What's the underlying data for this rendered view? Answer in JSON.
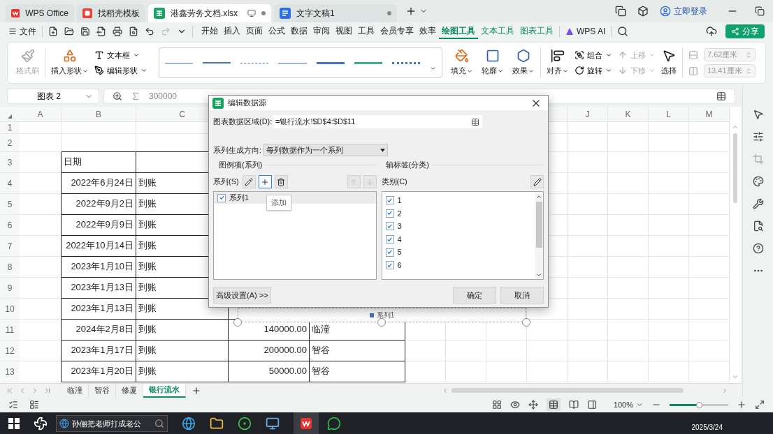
{
  "tabs": [
    {
      "label": "WPS Office",
      "kind": "wps",
      "selected": false
    },
    {
      "label": "找稻壳模板",
      "kind": "docer",
      "selected": false
    },
    {
      "label": "港鑫劳务文档.xlsx",
      "kind": "sheet",
      "selected": true
    },
    {
      "label": "文字文稿1",
      "kind": "writer",
      "selected": false
    }
  ],
  "account": "立即登录",
  "menu": {
    "file": "文件",
    "tabs": [
      {
        "label": "开始",
        "selected": false,
        "contextual": false
      },
      {
        "label": "插入",
        "selected": false,
        "contextual": false
      },
      {
        "label": "页面",
        "selected": false,
        "contextual": false
      },
      {
        "label": "公式",
        "selected": false,
        "contextual": false
      },
      {
        "label": "数据",
        "selected": false,
        "contextual": false
      },
      {
        "label": "审阅",
        "selected": false,
        "contextual": false
      },
      {
        "label": "视图",
        "selected": false,
        "contextual": false
      },
      {
        "label": "工具",
        "selected": false,
        "contextual": false
      },
      {
        "label": "会员专享",
        "selected": false,
        "contextual": false
      },
      {
        "label": "效率",
        "selected": false,
        "contextual": false
      },
      {
        "label": "绘图工具",
        "selected": true,
        "contextual": true
      },
      {
        "label": "文本工具",
        "selected": false,
        "contextual": true
      },
      {
        "label": "图表工具",
        "selected": false,
        "contextual": true
      }
    ],
    "ai": "WPS AI",
    "share": "分享"
  },
  "ribbon": {
    "format_painter": {
      "label": "格式刷",
      "disabled": true
    },
    "insert_shape": "插入形状",
    "text_box": "文本框",
    "edit_shape": "编辑形状",
    "line_styles": [
      {
        "kind": "thin",
        "color": "#4472c4"
      },
      {
        "kind": "medium",
        "color": "#4472c4"
      },
      {
        "kind": "dashed",
        "color": "#4472c4"
      },
      {
        "kind": "thin",
        "color": "#4472c4"
      },
      {
        "kind": "thick",
        "color": "#4472c4"
      },
      {
        "kind": "thick",
        "color": "#3bb18a"
      },
      {
        "kind": "dotted",
        "color": "#4472c4"
      }
    ],
    "fill": "填充",
    "outline": "轮廓",
    "effect": "效果",
    "align": "对齐",
    "group": "组合",
    "rotate": "旋转",
    "bring_forward": {
      "label": "上移",
      "disabled": true
    },
    "send_backward": {
      "label": "下移",
      "disabled": true
    },
    "select": "选择",
    "height": {
      "value": "7.62厘米",
      "disabled": true
    },
    "width": {
      "value": "13.41厘米",
      "disabled": true
    }
  },
  "formula_bar": {
    "name_box": "图表 2",
    "value": "300000"
  },
  "sheet": {
    "columns_left": [
      "A",
      "B",
      "C"
    ],
    "columns_right": [
      "J",
      "K",
      "L",
      "M"
    ],
    "rows": [
      {
        "number": "1"
      },
      {
        "number": "2"
      },
      {
        "number": "3",
        "kind": "header",
        "date": "日期"
      },
      {
        "number": "4",
        "kind": "data",
        "date": "2022年6月24日",
        "status": "到账"
      },
      {
        "number": "5",
        "kind": "data",
        "date": "2022年9月2日",
        "status": "到账"
      },
      {
        "number": "6",
        "kind": "data",
        "date": "2022年9月9日",
        "status": "到账"
      },
      {
        "number": "7",
        "kind": "data",
        "date": "2022年10月14日",
        "status": "到账"
      },
      {
        "number": "8",
        "kind": "data",
        "date": "2023年1月10日",
        "status": "到账"
      },
      {
        "number": "9",
        "kind": "data",
        "date": "2023年1月13日",
        "status": "到账"
      },
      {
        "number": "10",
        "kind": "data",
        "date": "2023年1月13日",
        "status": "到账"
      },
      {
        "number": "11",
        "kind": "data",
        "date": "2024年2月8日",
        "status": "到账",
        "amount": "140000.00",
        "site": "临潼"
      },
      {
        "number": "12",
        "kind": "data",
        "date": "2023年1月17日",
        "status": "到账",
        "amount": "200000.00",
        "site": "智谷"
      },
      {
        "number": "13",
        "kind": "data",
        "date": "2023年1月20日",
        "status": "到账",
        "amount": "50000.00",
        "site": "智谷"
      }
    ],
    "chart": {
      "legend": "系列1"
    }
  },
  "dialog": {
    "title": "编辑数据源",
    "range_label": "图表数据区域(D):",
    "range_value": "=银行流水!$D$4:$D$11",
    "direction_label": "系列生成方向:",
    "direction_value": "每列数据作为一个系列",
    "legend_group": {
      "title": "图例项(系列)",
      "label": "系列(S)",
      "buttons": [
        {
          "kind": "edit",
          "disabled": false,
          "focused": false
        },
        {
          "kind": "add",
          "disabled": false,
          "focused": true
        },
        {
          "kind": "delete",
          "disabled": false,
          "focused": false
        },
        {
          "kind": "up",
          "disabled": true,
          "focused": false
        },
        {
          "kind": "down",
          "disabled": true,
          "focused": false
        }
      ],
      "tooltip": "添加",
      "items": [
        {
          "label": "系列1",
          "checked": true,
          "selected": true
        }
      ]
    },
    "axis_group": {
      "title": "轴标签(分类)",
      "label": "类别(C)",
      "items": [
        {
          "label": "1",
          "checked": true
        },
        {
          "label": "2",
          "checked": true
        },
        {
          "label": "3",
          "checked": true
        },
        {
          "label": "4",
          "checked": true
        },
        {
          "label": "5",
          "checked": true
        },
        {
          "label": "6",
          "checked": true
        }
      ]
    },
    "advanced": "高级设置(A) >>",
    "ok": "确定",
    "cancel": "取消"
  },
  "sheet_tabs": [
    {
      "label": "临潼",
      "selected": false
    },
    {
      "label": "智谷",
      "selected": false
    },
    {
      "label": "修厦",
      "selected": false
    },
    {
      "label": "银行流水",
      "selected": true
    }
  ],
  "status_bar": {
    "zoom": {
      "label": "100%",
      "level": 0.5
    }
  },
  "taskbar": {
    "search": "孙俪把老师打成老公",
    "date": "2025/3/24"
  }
}
